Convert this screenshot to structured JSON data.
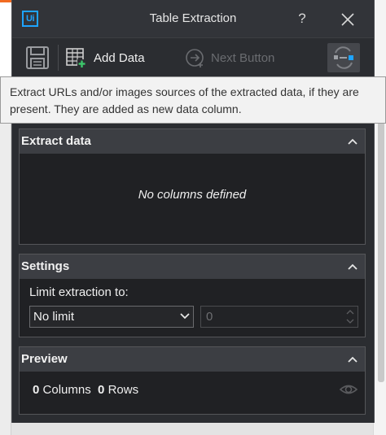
{
  "window": {
    "title": "Table Extraction",
    "logo_text": "Ui",
    "help_label": "?"
  },
  "toolbar": {
    "add_data_label": "Add Data",
    "next_button_label": "Next Button"
  },
  "tooltip": {
    "text": "Extract URLs and/or images sources of the extracted data, if they are present. They are added as new data column."
  },
  "extract_section": {
    "header": "Extract data",
    "empty_text": "No columns defined"
  },
  "settings_section": {
    "header": "Settings",
    "limit_label": "Limit extraction to:",
    "limit_selected": "No limit",
    "limit_value": "0"
  },
  "preview_section": {
    "header": "Preview",
    "columns_count": "0",
    "columns_label": "Columns",
    "rows_count": "0",
    "rows_label": "Rows"
  },
  "colors": {
    "accent": "#1ea4ff",
    "brand_orange": "#f26b21",
    "window_bg": "#2b2d31",
    "tooltip_bg": "#f2f2f2"
  },
  "icons": [
    "uipath-logo-icon",
    "help-icon",
    "close-icon",
    "save-icon",
    "add-data-icon",
    "next-button-icon",
    "correlate-urls-icon",
    "chevron-up-icon",
    "chevron-down-icon",
    "eye-icon"
  ]
}
